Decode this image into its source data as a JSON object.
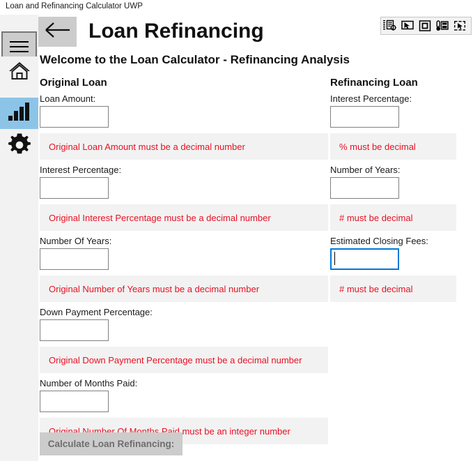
{
  "window": {
    "title": "Loan and Refinancing Calculator UWP"
  },
  "inspector_toolbar": {
    "buttons": [
      {
        "name": "inspect-properties-icon",
        "label": "Inspect Properties"
      },
      {
        "name": "select-element-icon",
        "label": "Select Element"
      },
      {
        "name": "highlight-rectangle-icon",
        "label": "Highlight Rectangle"
      },
      {
        "name": "measure-element-icon",
        "label": "Measure Element"
      },
      {
        "name": "capture-region-icon",
        "label": "Capture Region"
      }
    ]
  },
  "nav": {
    "menu_label": "Menu",
    "items": [
      {
        "name": "home",
        "label": "Home",
        "icon": "home-icon",
        "selected": false
      },
      {
        "name": "chart",
        "label": "Charts",
        "icon": "bar-chart-icon",
        "selected": true
      },
      {
        "name": "settings",
        "label": "Settings",
        "icon": "gear-icon",
        "selected": false
      }
    ],
    "selected_color": "#8cc4e8"
  },
  "header": {
    "back_label": "Back",
    "title": "Loan Refinancing",
    "welcome": "Welcome to the Loan Calculator - Refinancing Analysis"
  },
  "original_loan": {
    "heading": "Original Loan",
    "fields": [
      {
        "label": "Loan Amount:",
        "value": "",
        "placeholder": "",
        "focused": false,
        "error": "Original Loan Amount must be a decimal number"
      },
      {
        "label": "Interest Percentage:",
        "value": "",
        "placeholder": "",
        "focused": false,
        "error": "Original Interest Percentage must be a decimal number"
      },
      {
        "label": "Number Of Years:",
        "value": "",
        "placeholder": "",
        "focused": false,
        "error": "Original Number of Years must be a decimal number"
      },
      {
        "label": "Down Payment Percentage:",
        "value": "",
        "placeholder": "",
        "focused": false,
        "error": "Original Down Payment Percentage must be a decimal number"
      },
      {
        "label": "Number of Months Paid:",
        "value": "",
        "placeholder": "",
        "focused": false,
        "error": "Original Number Of Months Paid must be an integer number"
      }
    ]
  },
  "refinancing_loan": {
    "heading": "Refinancing Loan",
    "fields": [
      {
        "label": "Interest Percentage:",
        "value": "",
        "placeholder": "",
        "focused": false,
        "error": "% must be decimal"
      },
      {
        "label": "Number of Years:",
        "value": "",
        "placeholder": "",
        "focused": false,
        "error": "# must be decimal"
      },
      {
        "label": "Estimated Closing Fees:",
        "value": "",
        "placeholder": "",
        "focused": true,
        "error": "# must be decimal"
      }
    ]
  },
  "actions": {
    "calculate_label": "Calculate Loan Refinancing:"
  },
  "colors": {
    "error_text": "#e81123",
    "error_background": "#f2f2f2",
    "focus_border": "#0078d7",
    "nav_selected": "#8cc4e8",
    "button_face": "#cccccc",
    "button_disabled_text": "#6e6e6e"
  }
}
